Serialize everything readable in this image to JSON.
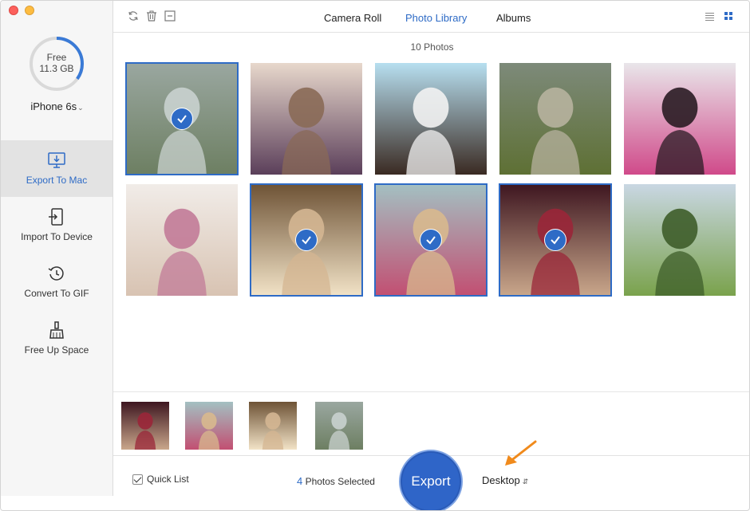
{
  "sidebar": {
    "storage_label": "Free",
    "storage_value": "11.3 GB",
    "storage_fraction": 0.35,
    "device_name": "iPhone 6s",
    "nav": [
      {
        "label": "Export To Mac",
        "icon": "monitor-export-icon",
        "active": true
      },
      {
        "label": "Import To Device",
        "icon": "import-device-icon",
        "active": false
      },
      {
        "label": "Convert To GIF",
        "icon": "convert-gif-icon",
        "active": false
      },
      {
        "label": "Free Up Space",
        "icon": "broom-icon",
        "active": false
      }
    ]
  },
  "toolbar": {
    "icons": [
      "refresh-icon",
      "trash-icon",
      "minus-box-icon"
    ],
    "tabs": [
      {
        "label": "Camera Roll",
        "active": false
      },
      {
        "label": "Photo Library",
        "active": true
      },
      {
        "label": "Albums",
        "active": false
      }
    ],
    "view_icons": [
      "list-view-icon",
      "grid-view-icon"
    ]
  },
  "main": {
    "photo_count": "10 Photos",
    "photos": [
      {
        "selected": true,
        "palette": [
          "#9aa7a0",
          "#c9d2cf",
          "#6d7f62"
        ]
      },
      {
        "selected": false,
        "palette": [
          "#e8d8cc",
          "#8a6a57",
          "#5b3f5a"
        ]
      },
      {
        "selected": false,
        "palette": [
          "#b7dff0",
          "#f2f2f2",
          "#3a2a22"
        ]
      },
      {
        "selected": false,
        "palette": [
          "#7d8a7a",
          "#b7b29f",
          "#5e7034"
        ]
      },
      {
        "selected": false,
        "palette": [
          "#e9e6ea",
          "#2a1c24",
          "#d04a8a"
        ]
      },
      {
        "selected": false,
        "palette": [
          "#f1ece8",
          "#c27b98",
          "#d8c3b2"
        ]
      },
      {
        "selected": true,
        "palette": [
          "#6e5336",
          "#d4b692",
          "#f2e3c7"
        ]
      },
      {
        "selected": true,
        "palette": [
          "#a3c0c2",
          "#d8b98e",
          "#c24f72"
        ]
      },
      {
        "selected": true,
        "palette": [
          "#3e1620",
          "#9a2638",
          "#c9a78b"
        ]
      },
      {
        "selected": false,
        "palette": [
          "#c9d7e3",
          "#3e5d2a",
          "#7aa24c"
        ]
      }
    ]
  },
  "tray": {
    "items": [
      {
        "palette": [
          "#3e1620",
          "#9a2638",
          "#c9a78b"
        ]
      },
      {
        "palette": [
          "#a3c0c2",
          "#d8b98e",
          "#c24f72"
        ]
      },
      {
        "palette": [
          "#6e5336",
          "#d4b692",
          "#f2e3c7"
        ]
      },
      {
        "palette": [
          "#9aa7a0",
          "#c9d2cf",
          "#6d7f62"
        ]
      }
    ]
  },
  "bottombar": {
    "quick_list_label": "Quick List",
    "selected_number": "4",
    "selected_suffix": " Photos Selected",
    "export_label": "Export",
    "destination": "Desktop"
  },
  "colors": {
    "accent": "#2e6bc6",
    "arrow": "#f08a1c"
  }
}
